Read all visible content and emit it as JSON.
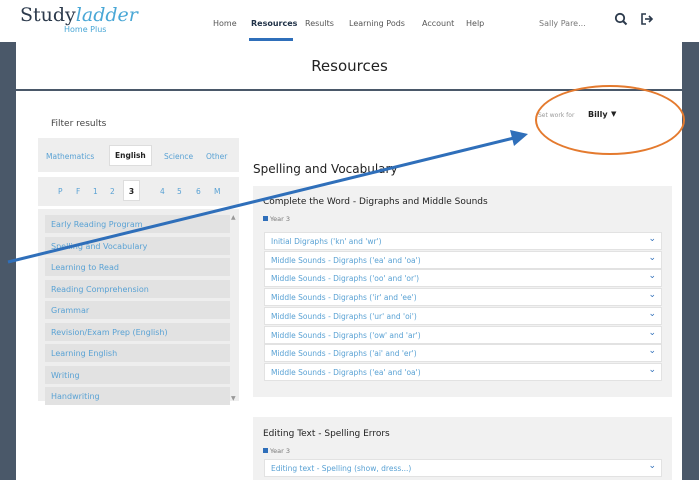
{
  "logo": {
    "study": "Study",
    "ladder": "ladder",
    "plus": "Home Plus"
  },
  "nav": [
    {
      "label": "Home"
    },
    {
      "label": "Resources"
    },
    {
      "label": "Results"
    },
    {
      "label": "Learning Pods"
    },
    {
      "label": "Account"
    },
    {
      "label": "Help"
    }
  ],
  "user": {
    "name": "Sally Pare..."
  },
  "icons": {
    "search": "search-icon",
    "logout": "logout-icon"
  },
  "page": {
    "title": "Resources"
  },
  "filter": {
    "label": "Filter results",
    "subjects": [
      "Mathematics",
      "English",
      "Science",
      "Other"
    ],
    "years": [
      "P",
      "F",
      "1",
      "2",
      "3",
      "4",
      "5",
      "6",
      "M"
    ],
    "categories": [
      "Early Reading Program",
      "Spelling and Vocabulary",
      "Learning to Read",
      "Reading Comprehension",
      "Grammar",
      "Revision/Exam Prep (English)",
      "Learning English",
      "Writing",
      "Handwriting"
    ]
  },
  "set_work": {
    "label": "Set work for",
    "child": "Billy"
  },
  "section": {
    "title": "Spelling and Vocabulary"
  },
  "card1": {
    "title": "Complete the Word - Digraphs and Middle Sounds",
    "year": "Year 3",
    "items": [
      "Initial Digraphs ('kn' and 'wr')",
      "Middle Sounds - Digraphs ('ea' and 'oa')",
      "Middle Sounds - Digraphs ('oo' and 'or')",
      "Middle Sounds - Digraphs ('ir' and 'ee')",
      "Middle Sounds - Digraphs ('ur' and 'oi')",
      "Middle Sounds - Digraphs ('ow' and 'ar')",
      "Middle Sounds - Digraphs ('ai' and 'er')",
      "Middle Sounds - Digraphs ('ea' and 'oa')"
    ]
  },
  "card2": {
    "title": "Editing Text - Spelling Errors",
    "year": "Year 3",
    "items": [
      "Editing text - Spelling (show, dress...)"
    ]
  },
  "colors": {
    "brand_dark": "#4a5869",
    "accent_blue": "#2f6fba",
    "link_blue": "#5aa2d4",
    "annotation_orange": "#e47a2e"
  }
}
